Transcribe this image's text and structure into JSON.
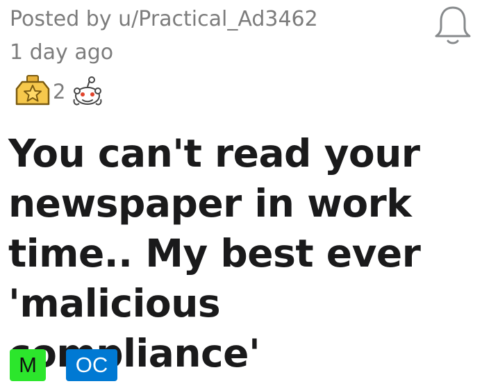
{
  "post": {
    "posted_by": "Posted by u/Practical_Ad3462",
    "time": "1 day ago",
    "title": "You can't read your newspaper in work time.. My best ever 'malicious compliance'",
    "awards": {
      "icon": "gold-star-award-icon",
      "count": "2",
      "extra_icon": "snoo-award-icon"
    },
    "flairs": [
      {
        "label": "M",
        "color": "#2ce62c"
      },
      {
        "label": "OC",
        "color": "#0079d3"
      }
    ],
    "follow_icon": "bell-icon"
  }
}
